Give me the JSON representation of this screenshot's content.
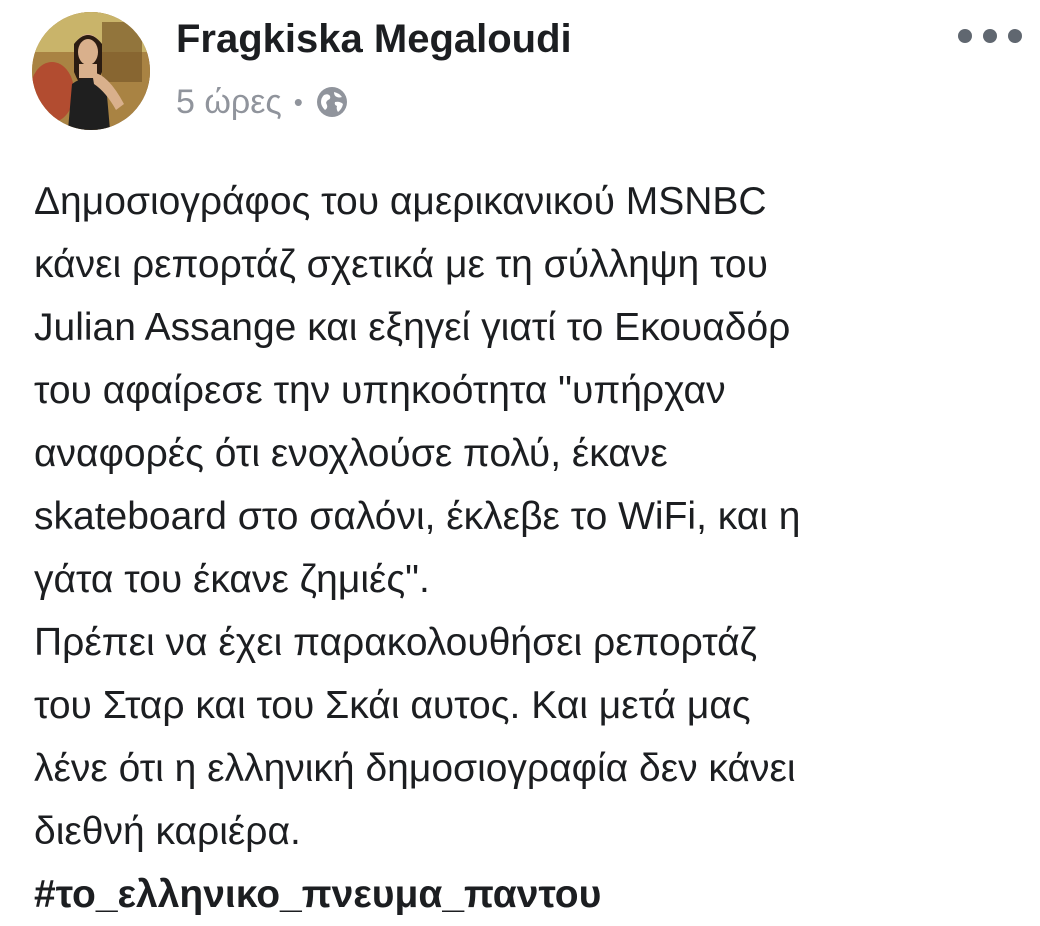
{
  "post": {
    "author": "Fragkiska Megaloudi",
    "timestamp": "5 ώρες",
    "separator": "•",
    "privacy_icon": "globe-icon",
    "more_icon": "more-options-icon",
    "body_lines": [
      "Δημοσιογράφος του αμερικανικού MSNBC",
      "κάνει ρεπορτάζ σχετικά με τη σύλληψη του",
      "Julian Assange και εξηγεί γιατί το Εκουαδόρ",
      "του αφαίρεσε  την υπηκοότητα  \"υπήρχαν",
      "αναφορές ότι ενοχλούσε πολύ, έκανε",
      "skateboard στο σαλόνι, έκλεβε το WiFi, και η",
      "γάτα του έκανε ζημιές\".",
      "Πρέπει να έχει παρακολουθήσει ρεπορτάζ",
      "του Σταρ και του Σκάι αυτος. Και μετά μας",
      "λένε ότι η ελληνική δημοσιογραφία δεν κάνει",
      "διεθνή καριέρα."
    ],
    "hashtag": "#το_ελληνικο_πνευμα_παντου"
  },
  "colors": {
    "text": "#1c1e21",
    "meta": "#90949c",
    "icon": "#606770",
    "background": "#ffffff"
  }
}
